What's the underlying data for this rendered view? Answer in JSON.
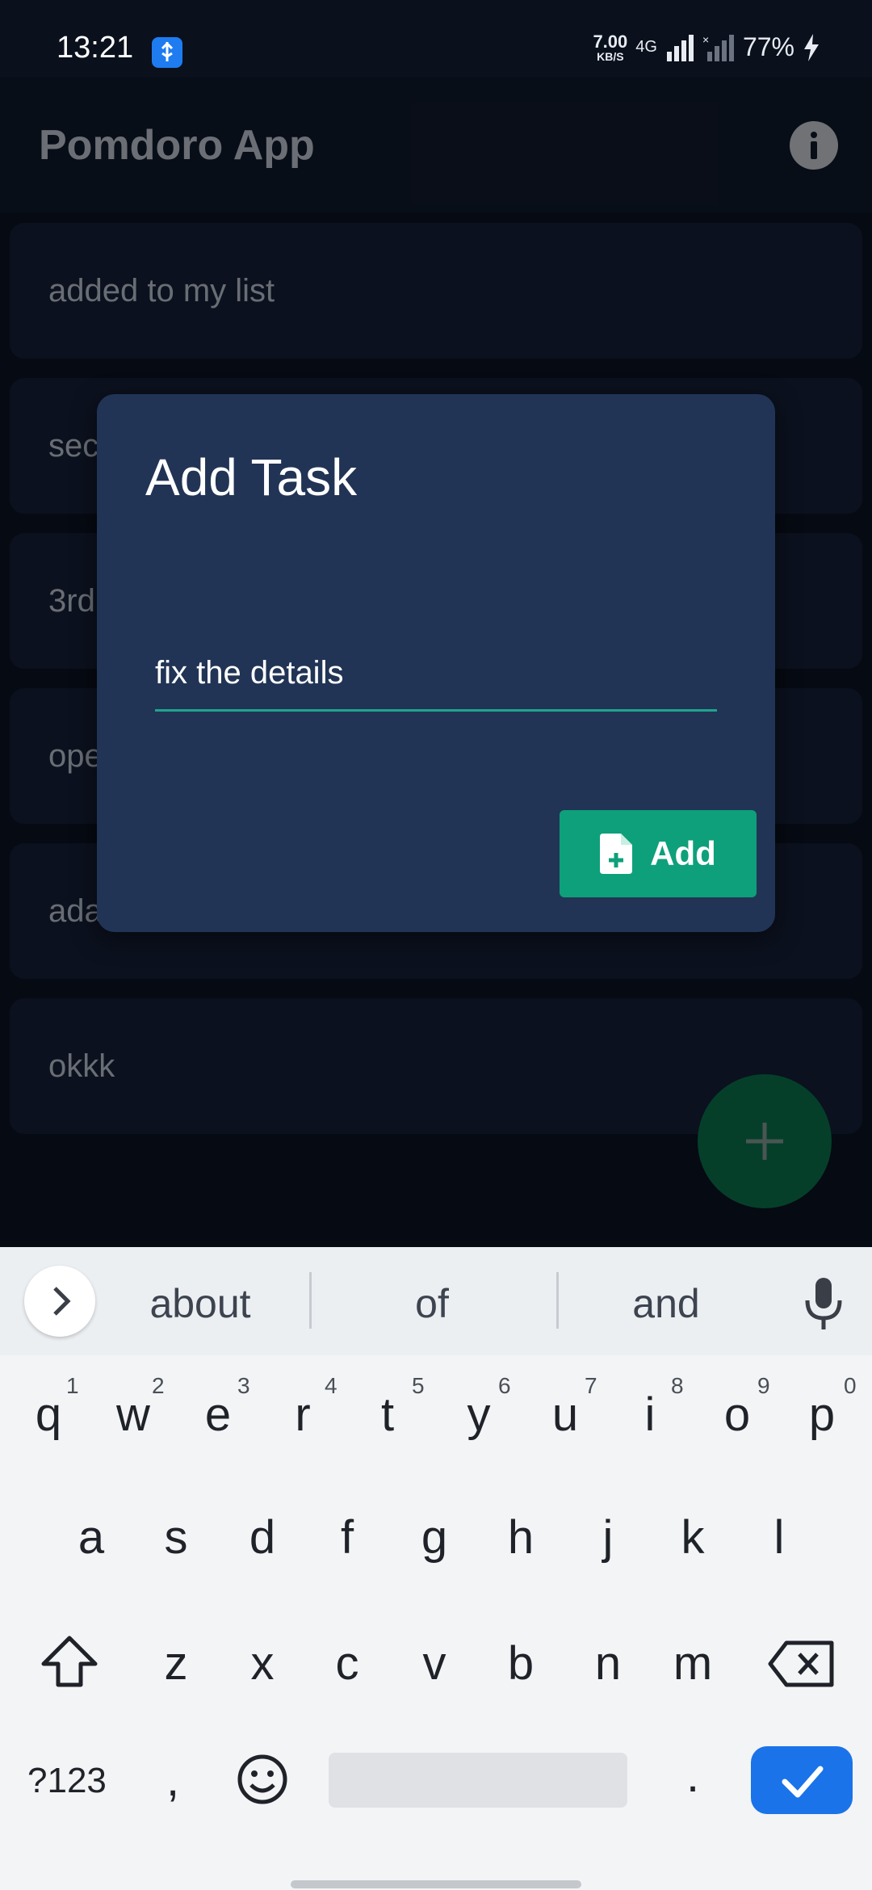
{
  "status_bar": {
    "time": "13:21",
    "net_speed_value": "7.00",
    "net_speed_unit": "KB/S",
    "network_type": "4G",
    "battery": "77%"
  },
  "app_bar": {
    "title": "Pomdoro App",
    "info_icon": "info-icon"
  },
  "tasks": [
    "added to my list",
    "sec",
    "3rd",
    "ope",
    "ada",
    "okkk"
  ],
  "dialog": {
    "title": "Add Task",
    "input_value": "fix the details",
    "add_button_label": "Add"
  },
  "fab": {
    "label": "+"
  },
  "keyboard": {
    "suggestions": [
      "about",
      "of",
      "and"
    ],
    "row1": [
      "q",
      "w",
      "e",
      "r",
      "t",
      "y",
      "u",
      "i",
      "o",
      "p"
    ],
    "row1_hints": [
      "1",
      "2",
      "3",
      "4",
      "5",
      "6",
      "7",
      "8",
      "9",
      "0"
    ],
    "row2": [
      "a",
      "s",
      "d",
      "f",
      "g",
      "h",
      "j",
      "k",
      "l"
    ],
    "row3": [
      "z",
      "x",
      "c",
      "v",
      "b",
      "n",
      "m"
    ],
    "symbols_label": "?123",
    "comma": ",",
    "period": "."
  },
  "colors": {
    "accent_green": "#0ea07a",
    "input_underline": "#1fa58e",
    "keyboard_enter": "#1a73e8",
    "dialog_bg": "#213455"
  }
}
